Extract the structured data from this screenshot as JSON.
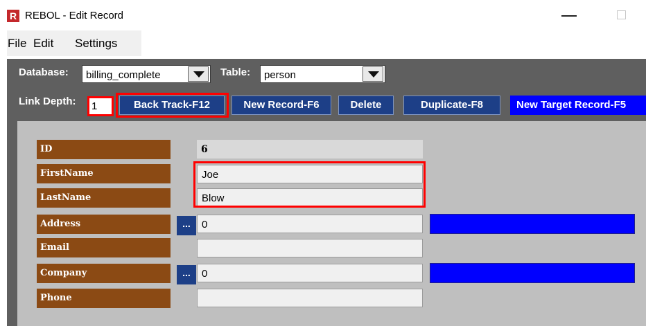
{
  "window": {
    "app_icon_letter": "R",
    "title": "REBOL - Edit Record"
  },
  "menu": {
    "items": [
      "File",
      "Edit",
      "Settings"
    ]
  },
  "toolbar": {
    "database_label": "Database:",
    "database_value": "billing_complete",
    "table_label": "Table:",
    "table_value": "person",
    "link_depth_label": "Link Depth:",
    "link_depth_value": "1",
    "buttons": {
      "back_track": "Back Track-F12",
      "new_record": "New Record-F6",
      "delete": "Delete",
      "duplicate": "Duplicate-F8",
      "new_target_record": "New Target Record-F5"
    }
  },
  "fields": [
    {
      "label": "ID",
      "value": "6"
    },
    {
      "label": "FirstName",
      "value": "Joe"
    },
    {
      "label": "LastName",
      "value": "Blow"
    },
    {
      "label": "Address",
      "value": "0",
      "link_button": "..."
    },
    {
      "label": "Email",
      "value": ""
    },
    {
      "label": "Company",
      "value": "0",
      "link_button": "..."
    },
    {
      "label": "Phone",
      "value": ""
    }
  ],
  "colors": {
    "highlight": "#ff0000",
    "button_blue": "#1d3f87",
    "bright_blue": "#0000ff",
    "label_brown": "#8b4a14"
  },
  "icons": [
    "minimize-icon",
    "maximize-icon",
    "dropdown-arrow-icon"
  ]
}
